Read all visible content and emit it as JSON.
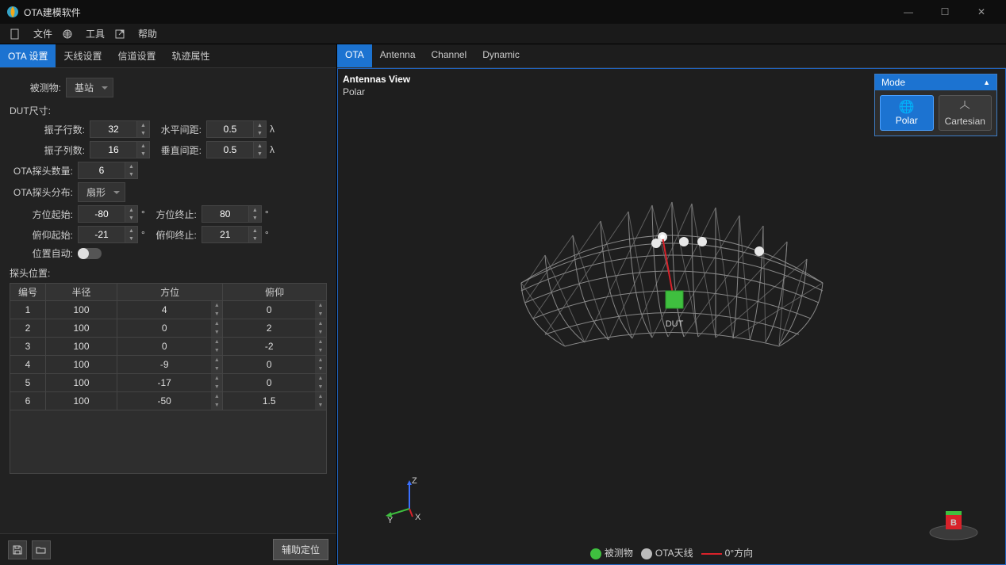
{
  "app": {
    "title": "OTA建模软件"
  },
  "menu": {
    "file": "文件",
    "tools": "工具",
    "help": "帮助"
  },
  "left_tabs": [
    "OTA 设置",
    "天线设置",
    "信道设置",
    "轨迹属性"
  ],
  "fields": {
    "dut_label": "被测物:",
    "dut_value": "基站",
    "dut_size_label": "DUT尺寸:",
    "rows_label": "振子行数:",
    "rows_value": "32",
    "h_spacing_label": "水平间距:",
    "h_spacing_value": "0.5",
    "cols_label": "振子列数:",
    "cols_value": "16",
    "v_spacing_label": "垂直间距:",
    "v_spacing_value": "0.5",
    "lambda": "λ",
    "probe_count_label": "OTA探头数量:",
    "probe_count_value": "6",
    "probe_dist_label": "OTA探头分布:",
    "probe_dist_value": "扇形",
    "az_start_label": "方位起始:",
    "az_start_value": "-80",
    "az_end_label": "方位终止:",
    "az_end_value": "80",
    "el_start_label": "俯仰起始:",
    "el_start_value": "-21",
    "el_end_label": "俯仰终止:",
    "el_end_value": "21",
    "deg": "°",
    "auto_pos_label": "位置自动:",
    "probe_pos_label": "探头位置:"
  },
  "table": {
    "headers": [
      "编号",
      "半径",
      "方位",
      "俯仰"
    ],
    "rows": [
      {
        "id": "1",
        "r": "100",
        "az": "4",
        "el": "0"
      },
      {
        "id": "2",
        "r": "100",
        "az": "0",
        "el": "2"
      },
      {
        "id": "3",
        "r": "100",
        "az": "0",
        "el": "-2"
      },
      {
        "id": "4",
        "r": "100",
        "az": "-9",
        "el": "0"
      },
      {
        "id": "5",
        "r": "100",
        "az": "-17",
        "el": "0"
      },
      {
        "id": "6",
        "r": "100",
        "az": "-50",
        "el": "1.5"
      }
    ]
  },
  "footer": {
    "aux_btn": "辅助定位"
  },
  "right_tabs": [
    "OTA",
    "Antenna",
    "Channel",
    "Dynamic"
  ],
  "view": {
    "title": "Antennas View",
    "sub": "Polar",
    "dut_label": "DUT",
    "axis": {
      "x": "X",
      "y": "Y",
      "z": "Z"
    },
    "compass": "B"
  },
  "mode": {
    "title": "Mode",
    "polar": "Polar",
    "cartesian": "Cartesian"
  },
  "legend": {
    "dut": "被测物",
    "ota": "OTA天线",
    "zero": "0°方向"
  }
}
